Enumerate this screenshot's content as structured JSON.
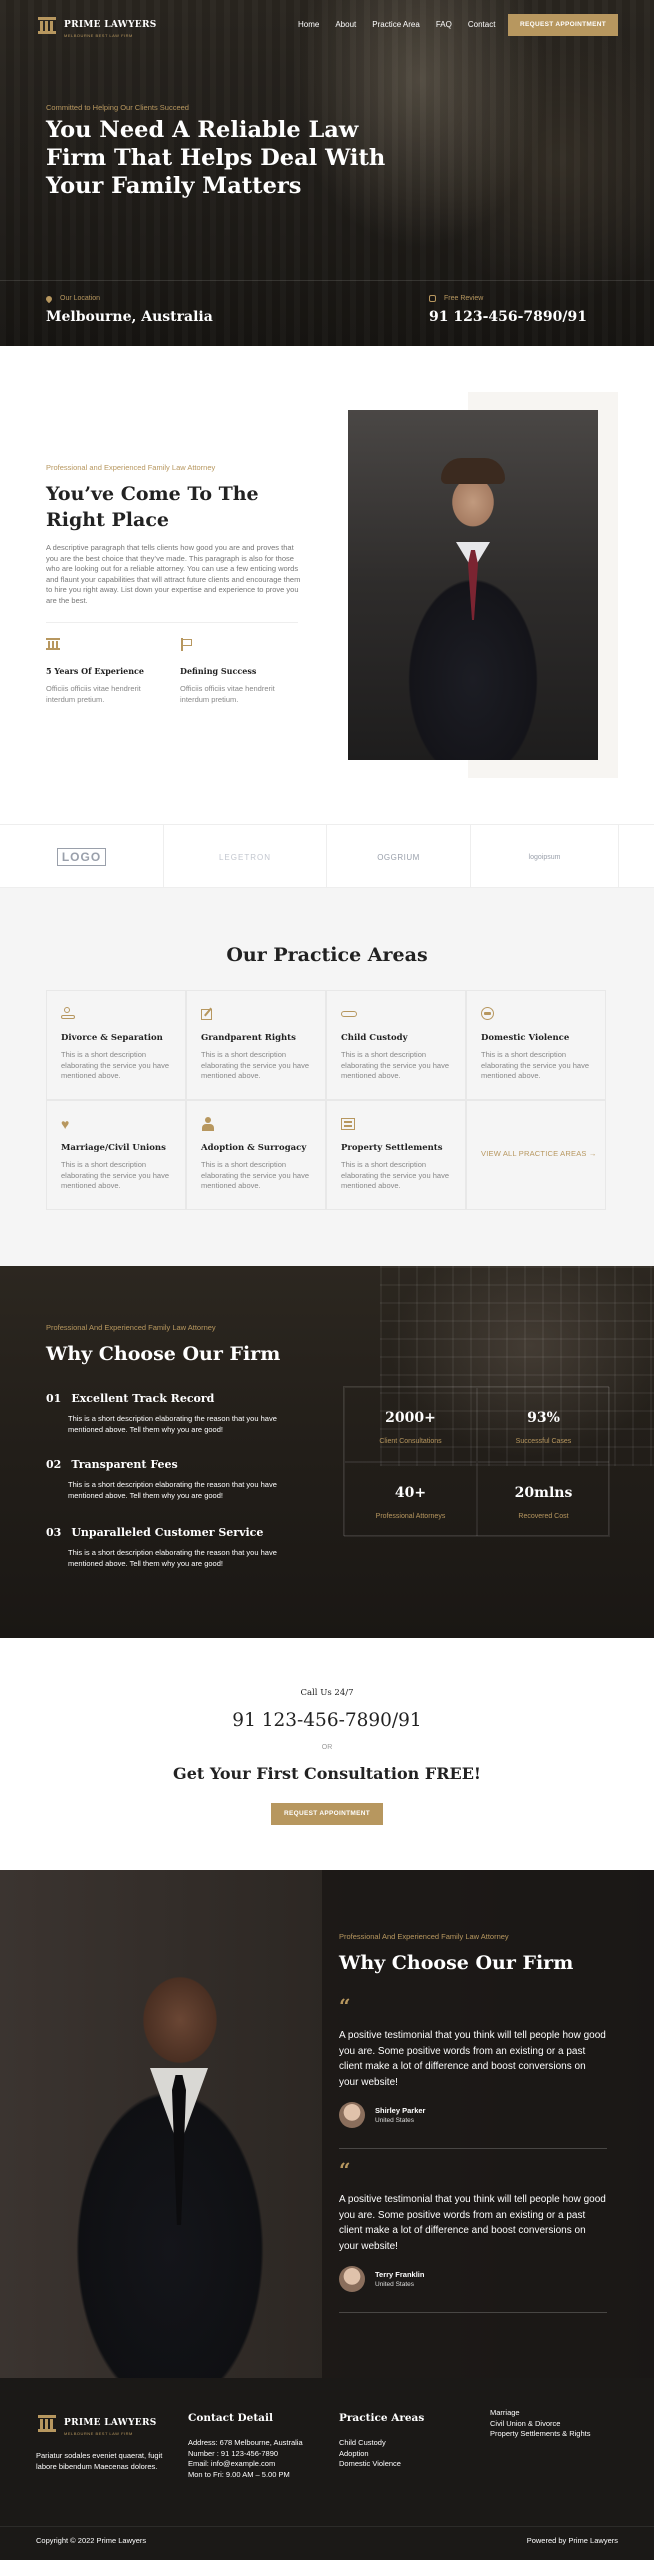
{
  "brand": {
    "name": "PRIME LAWYERS",
    "tagline": "MELBOURNE BEST LAW FIRM"
  },
  "nav": {
    "links": [
      "Home",
      "About",
      "Practice Area",
      "FAQ",
      "Contact"
    ],
    "cta": "REQUEST APPOINTMENT"
  },
  "hero": {
    "kicker": "Committed to Helping Our Clients Succeed",
    "title": "You Need A Reliable Law Firm That Helps Deal With Your Family Matters",
    "location_label": "Our Location",
    "location_value": "Melbourne, Australia",
    "phone_label": "Free Review",
    "phone_value": "91 123-456-7890/91"
  },
  "about": {
    "kicker": "Professional and Experienced Family Law Attorney",
    "title": "You’ve Come To The Right Place",
    "description": "A descriptive paragraph that tells clients how good you are and proves that you are the best choice that they’ve made. This paragraph is also for those who are looking out for a reliable attorney. You can use a few enticing words and flaunt your capabilities that will attract future clients and encourage them to hire you right away. List down your expertise and experience to prove you are the best.",
    "features": [
      {
        "icon": "pillar-icon",
        "title": "5 Years Of Experience",
        "desc": "Officiis officiis vitae hendrerit interdum pretium."
      },
      {
        "icon": "flag-icon",
        "title": "Defining Success",
        "desc": "Officiis officiis vitae hendrerit interdum pretium."
      }
    ]
  },
  "partners": [
    "LOGO",
    "LEGETRON",
    "OGGRIUM",
    "logoipsum"
  ],
  "practice": {
    "title": "Our Practice Areas",
    "areas": [
      {
        "icon": "hand-coins-icon",
        "title": "Divorce & Separation",
        "desc": "This is a short description elaborating the service you have mentioned above."
      },
      {
        "icon": "pen-icon",
        "title": "Grandparent Rights",
        "desc": "This is a short description elaborating the service you have mentioned above."
      },
      {
        "icon": "handshake-icon",
        "title": "Child Custody",
        "desc": "This is a short description elaborating the service you have mentioned above."
      },
      {
        "icon": "face-icon",
        "title": "Domestic Violence",
        "desc": "This is a short description elaborating the service you have mentioned above."
      },
      {
        "icon": "heart-icon",
        "title": "Marriage/Civil Unions",
        "desc": "This is a short description elaborating the service you have mentioned above."
      },
      {
        "icon": "person-icon",
        "title": "Adoption & Surrogacy",
        "desc": "This is a short description elaborating the service you have mentioned above."
      },
      {
        "icon": "building-icon",
        "title": "Property Settlements",
        "desc": "This is a short description elaborating the service you have mentioned above."
      }
    ],
    "view_all": "VIEW ALL PRACTICE AREAS →"
  },
  "why": {
    "kicker": "Professional And Experienced Family Law Attorney",
    "title": "Why Choose Our Firm",
    "items": [
      {
        "num": "01",
        "title": "Excellent Track Record",
        "desc": "This is a short description elaborating the reason that you have mentioned above. Tell them why you are good!"
      },
      {
        "num": "02",
        "title": "Transparent Fees",
        "desc": "This is a short description elaborating the reason that you have mentioned above. Tell them why you are good!"
      },
      {
        "num": "03",
        "title": "Unparalleled Customer Service",
        "desc": "This is a short description elaborating the reason that you have mentioned above. Tell them why you are good!"
      }
    ],
    "stats": [
      {
        "value": "2000+",
        "label": "Client Consultations"
      },
      {
        "value": "93%",
        "label": "Successful Cases"
      },
      {
        "value": "40+",
        "label": "Professional Attorneys"
      },
      {
        "value": "20mlns",
        "label": "Recovered Cost"
      }
    ]
  },
  "cta": {
    "call_label": "Call Us 24/7",
    "phone": "91 123-456-7890/91",
    "or": "OR",
    "heading": "Get Your First Consultation FREE!",
    "button": "REQUEST APPOINTMENT"
  },
  "testimonials": {
    "kicker": "Professional And Experienced Family Law Attorney",
    "title": "Why Choose Our Firm",
    "items": [
      {
        "text": "A positive testimonial that you think will tell people how good you are. Some positive words from an existing or a past client make a lot of difference and boost conversions on your website!",
        "name": "Shirley Parker",
        "country": "United States"
      },
      {
        "text": "A positive testimonial that you think will tell people how good you are. Some positive words from an existing or a past client make a lot of difference and boost conversions on your website!",
        "name": "Terry Franklin",
        "country": "United States"
      }
    ]
  },
  "footer": {
    "description": "Pariatur sodales eveniet quaerat, fugit labore bibendum Maecenas dolores.",
    "contact_title": "Contact Detail",
    "contact": [
      "Address: 678 Melbourne, Australia",
      "Number : 91 123-456-7890",
      "Email: info@example.com",
      "Mon to Fri: 9.00 AM – 5.00 PM"
    ],
    "practice_title": "Practice Areas",
    "practice_col1": [
      "Child Custody",
      "Adoption",
      "Domestic Violence"
    ],
    "practice_col2": [
      "Marriage",
      "Civil Union & Divorce",
      "Property Settlements & Rights"
    ],
    "copyright": "Copyright © 2022 Prime Lawyers",
    "powered": "Powered by Prime Lawyers"
  },
  "colors": {
    "accent": "#b7975f",
    "dark": "#1b1917",
    "light_bg": "#f5f5f5"
  }
}
